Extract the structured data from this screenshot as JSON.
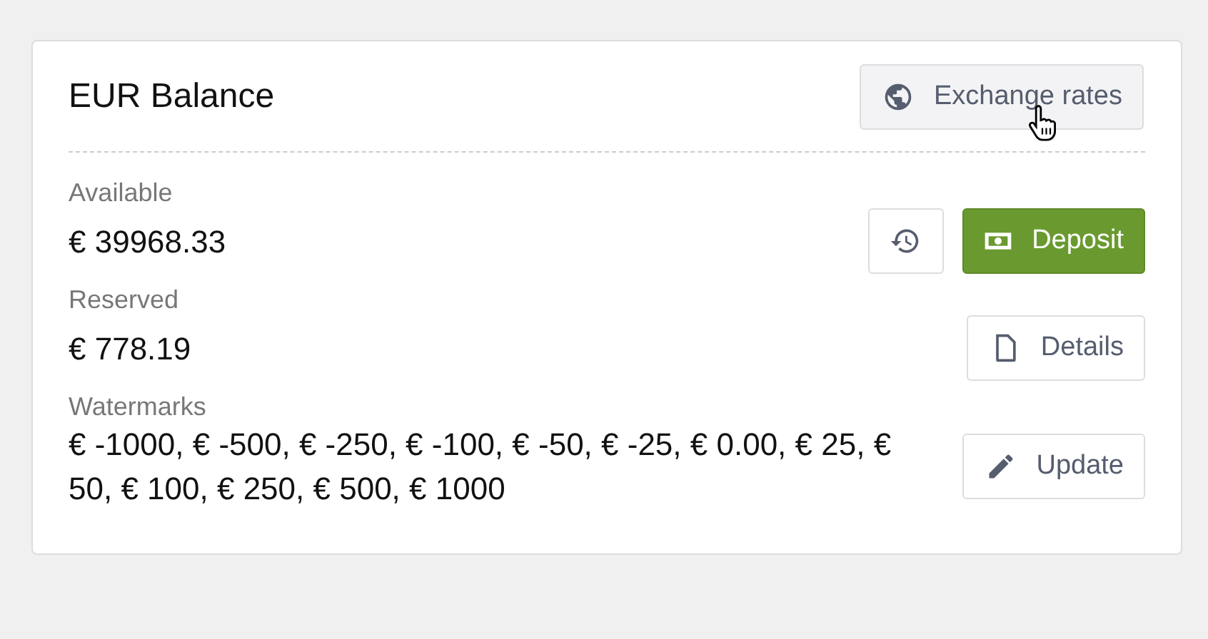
{
  "card": {
    "title": "EUR Balance",
    "header_button": {
      "label": "Exchange rates",
      "hovered": true
    }
  },
  "sections": [
    {
      "label": "Available",
      "value": "€ 39968.33",
      "buttons": [
        {
          "kind": "icon"
        },
        {
          "kind": "primary",
          "label": "Deposit"
        }
      ]
    },
    {
      "label": "Reserved",
      "value": "€ 778.19",
      "buttons": [
        {
          "kind": "default",
          "label": "Details"
        }
      ]
    },
    {
      "label": "Watermarks",
      "value": "€ -1000, € -500, € -250, € -100, € -50, € -25, € 0.00, € 25, € 50, € 100, € 250, € 500, € 1000",
      "buttons": [
        {
          "kind": "default",
          "label": "Update"
        }
      ]
    }
  ]
}
